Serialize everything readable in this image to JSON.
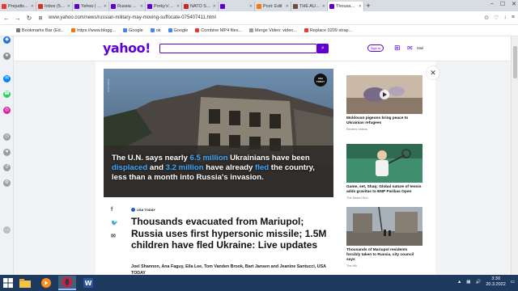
{
  "browser": {
    "tabs": [
      {
        "label": "Prejudist - sl",
        "color": "#e53935",
        "active": false
      },
      {
        "label": "Inbox (5,283",
        "color": "#d93025",
        "active": false
      },
      {
        "label": "Yahoo | Mail",
        "color": "#6001d2",
        "active": false
      },
      {
        "label": "Russia uses",
        "color": "#6001d2",
        "active": false
      },
      {
        "label": "Porky's' stor",
        "color": "#6001d2",
        "active": false
      },
      {
        "label": "NATO Shoul",
        "color": "#c62828",
        "active": false
      },
      {
        "label": "",
        "color": "#6001d2",
        "active": false
      },
      {
        "label": "Post: Edit",
        "color": "#f57c00",
        "active": false
      },
      {
        "label": "THE AUSER",
        "color": "#6d4c41",
        "active": false
      },
      {
        "label": "Thousands e",
        "color": "#6001d2",
        "active": true
      }
    ],
    "url": "www.yahoo.com/news/russian-military-may-moving-suffocate-075407411.html",
    "bookmarks": [
      {
        "label": "Bookmarks Bar (Ed...",
        "color": "#777777"
      },
      {
        "label": "https://www.blogg...",
        "color": "#ff6f00"
      },
      {
        "label": "Google",
        "color": "#4285f4"
      },
      {
        "label": "ok",
        "color": "#4285f4"
      },
      {
        "label": "Google",
        "color": "#4285f4"
      },
      {
        "label": "Combine MP4 files...",
        "color": "#e53935"
      },
      {
        "label": "Merge Video: video...",
        "color": "#9e9e9e"
      },
      {
        "label": "Replace 0209 strap...",
        "color": "#e53935"
      }
    ]
  },
  "yahoo": {
    "logo": "yahoo!",
    "sign_in": "Sign in",
    "mail_label": "Mail",
    "accent": "#6001d2"
  },
  "article": {
    "video_caption_parts": [
      {
        "text": "The U.N. says nearly ",
        "hl": false
      },
      {
        "text": "6.5 million",
        "hl": true
      },
      {
        "text": " Ukrainians have been ",
        "hl": false
      },
      {
        "text": "displaced",
        "hl": true
      },
      {
        "text": " and ",
        "hl": false
      },
      {
        "text": "3.2 million",
        "hl": true
      },
      {
        "text": " have already ",
        "hl": false
      },
      {
        "text": "fled",
        "hl": true
      },
      {
        "text": " the country, less than a month into Russia's invasion.",
        "hl": false
      }
    ],
    "video_badge": "USA TODAY",
    "source": "USA TODAY",
    "headline": "Thousands evacuated from Mariupol; Russia uses first hypersonic missile; 1.5M children have fled Ukraine: Live updates",
    "byline": "Joel Shannon, Ana Faguy, Ella Lee, Tom Vanden Brook, Bart Jansen and Jeanine Santucci, USA TODAY"
  },
  "side_cards": [
    {
      "title": "Moldovan pigeons bring peace to Ukrainian refugees",
      "provider": "Reuters Videos"
    },
    {
      "title": "Game, set, Shaq: Global nature of tennis adds gravitas to BNP Paribas Open",
      "provider": "The Desert Sun"
    },
    {
      "title": "Thousands of Mariupol residents forcibly taken to Russia, city council says",
      "provider": "The Hill"
    }
  ],
  "taskbar": {
    "time": "3:30",
    "date": "20.3.2022"
  }
}
